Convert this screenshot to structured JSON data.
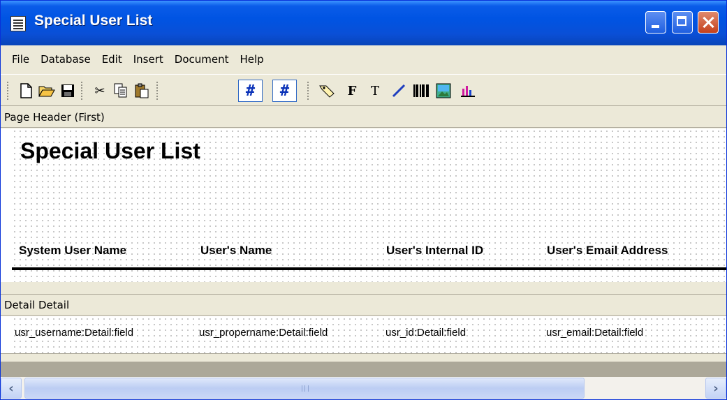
{
  "window": {
    "title": "Special User List"
  },
  "menu": {
    "items": [
      "File",
      "Database",
      "Edit",
      "Insert",
      "Document",
      "Help"
    ]
  },
  "toolbar": {
    "buttons": [
      {
        "name": "new-document-icon",
        "glyph": "🗋"
      },
      {
        "name": "open-folder-icon",
        "glyph": "📂"
      },
      {
        "name": "save-icon",
        "glyph": "💾"
      },
      {
        "name": "cut-icon",
        "glyph": "✂"
      },
      {
        "name": "copy-icon",
        "glyph": "📄"
      },
      {
        "name": "paste-icon",
        "glyph": "📋"
      },
      {
        "name": "grid-toggle-icon",
        "glyph": "#"
      },
      {
        "name": "snap-to-grid-icon",
        "glyph": "#"
      },
      {
        "name": "label-tool-icon",
        "glyph": "🏷"
      },
      {
        "name": "field-tool-icon",
        "glyph": "F"
      },
      {
        "name": "text-tool-icon",
        "glyph": "T"
      },
      {
        "name": "line-tool-icon",
        "glyph": "╱"
      },
      {
        "name": "barcode-tool-icon",
        "glyph": "‖‖"
      },
      {
        "name": "image-tool-icon",
        "glyph": "▣"
      },
      {
        "name": "chart-tool-icon",
        "glyph": "▮"
      }
    ]
  },
  "page_header": {
    "band_label": "Page Header (First)",
    "report_title": "Special User List",
    "columns": [
      "System User Name",
      "User's Name",
      "User's Internal ID",
      "User's Email Address"
    ]
  },
  "detail": {
    "band_label": "Detail Detail",
    "fields": [
      "usr_username:Detail:field",
      "usr_propername:Detail:field",
      "usr_id:Detail:field",
      "usr_email:Detail:field"
    ]
  }
}
